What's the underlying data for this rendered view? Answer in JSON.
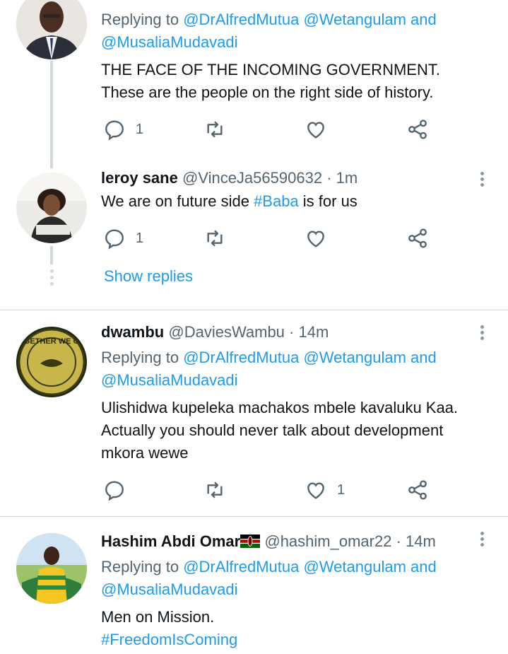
{
  "tweets": [
    {
      "name": "",
      "handle": "",
      "time": "",
      "replying_prefix": "Replying to",
      "replying_to": "@DrAlfredMutua @Wetangulam and",
      "replying_to_2": "@MusaliaMudavadi",
      "text_lines": [
        "THE FACE OF THE INCOMING GOVERNMENT.",
        "These are the people on the right side of history."
      ],
      "reply_count": "1",
      "retweet_count": "",
      "like_count": ""
    },
    {
      "name": "leroy sane",
      "handle": "@VinceJa56590632",
      "time": "· 1m",
      "text_prefix": "We are on future side ",
      "hashtag": "#Baba",
      "text_suffix": " is for us",
      "reply_count": "1",
      "retweet_count": "",
      "like_count": "",
      "show_replies": "Show replies"
    },
    {
      "name": "dwambu",
      "handle": "@DaviesWambu",
      "time": "· 14m",
      "replying_prefix": "Replying to",
      "replying_to": "@DrAlfredMutua @Wetangulam and",
      "replying_to_2": "@MusaliaMudavadi",
      "text_lines": [
        "Ulishidwa kupeleka machakos mbele kavaluku Kaa.",
        "Actually you should never talk about development",
        "mkora wewe"
      ],
      "avatar_text": "TOGETHER WE CAN",
      "reply_count": "",
      "retweet_count": "",
      "like_count": "1"
    },
    {
      "name": "Hashim Abdi Omar",
      "handle": "@hashim_omar22",
      "time": "· 14m",
      "replying_prefix": "Replying to",
      "replying_to": "@DrAlfredMutua @Wetangulam and",
      "replying_to_2": "@MusaliaMudavadi",
      "text_lines": [
        "Men on Mission."
      ],
      "hashtag": "#FreedomIsComing"
    }
  ],
  "colors": {
    "accent": "#1d9bf0",
    "text": "#0f1419",
    "secondary": "#536471",
    "divider": "#cfd9de"
  },
  "icons": [
    "reply-icon",
    "retweet-icon",
    "like-icon",
    "share-icon",
    "more-icon",
    "kenya-flag-icon"
  ]
}
